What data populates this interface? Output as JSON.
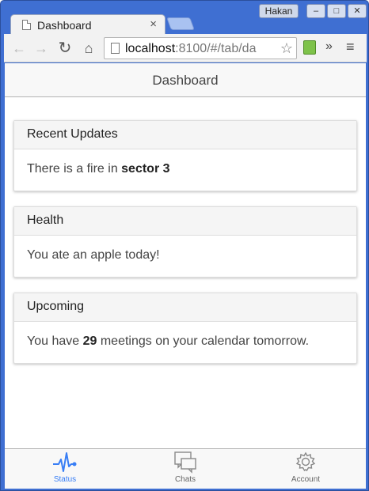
{
  "browser": {
    "tab_title": "Dashboard",
    "tab_close": "×",
    "user_name": "Hakan",
    "window_controls": {
      "minimize": "–",
      "maximize": "□",
      "close": "✕"
    },
    "nav": {
      "back": "←",
      "forward": "→",
      "reload": "↻",
      "home": "⌂"
    },
    "url_host": "localhost",
    "url_rest": ":8100/#/tab/da",
    "star": "☆",
    "overflow": "»",
    "menu": "≡"
  },
  "app": {
    "header_title": "Dashboard",
    "cards": [
      {
        "title": "Recent Updates",
        "body_prefix": "There is a fire in ",
        "body_bold": "sector 3",
        "body_suffix": ""
      },
      {
        "title": "Health",
        "body_prefix": "You ate an apple today!",
        "body_bold": "",
        "body_suffix": ""
      },
      {
        "title": "Upcoming",
        "body_prefix": "You have ",
        "body_bold": "29",
        "body_suffix": " meetings on your calendar tomorrow."
      }
    ],
    "tabs": [
      {
        "label": "Status",
        "icon": "pulse-icon",
        "active": true
      },
      {
        "label": "Chats",
        "icon": "chat-bubbles-icon",
        "active": false
      },
      {
        "label": "Account",
        "icon": "gear-icon",
        "active": false
      }
    ]
  },
  "colors": {
    "titlebar": "#3f6fd2",
    "accent_active_tab": "#387ef5",
    "inactive_icon": "#888888"
  }
}
